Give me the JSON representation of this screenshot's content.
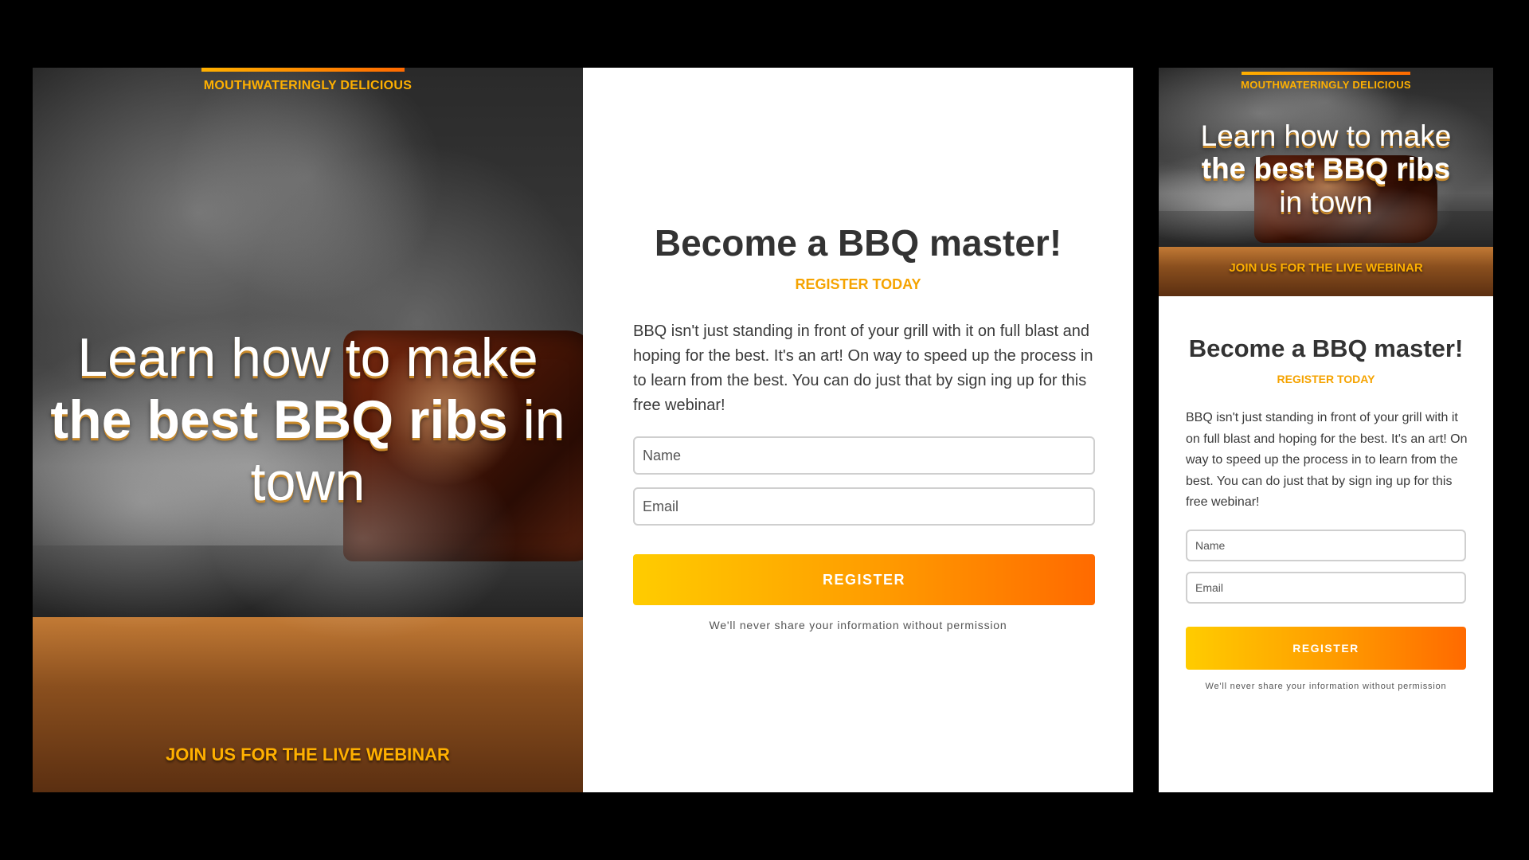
{
  "desktop": {
    "hero": {
      "kicker": "MOUTHWATERINGLY DELICIOUS",
      "title_line1": "Learn how to make",
      "title_bold": "the best BBQ ribs",
      "title_in": " in",
      "title_line3": "town",
      "footer": "JOIN US FOR THE LIVE WEBINAR"
    },
    "form": {
      "title": "Become a BBQ master!",
      "subtitle": "REGISTER TODAY",
      "body": "BBQ isn't just standing in front of your grill with it on full blast and hoping for the best. It's an art! On way to speed up the process in to learn from the best. You can do just that by sign ing up for this free webinar!",
      "name_placeholder": "Name",
      "email_placeholder": "Email",
      "button": "REGISTER",
      "privacy": "We'll never share your information without permission"
    }
  },
  "mobile": {
    "hero": {
      "kicker": "MOUTHWATERINGLY DELICIOUS",
      "title_line1": "Learn how to make",
      "title_bold": "the best BBQ ribs",
      "title_line3": "in town",
      "footer": "JOIN US FOR THE LIVE WEBINAR"
    },
    "form": {
      "title": "Become a BBQ master!",
      "subtitle": "REGISTER TODAY",
      "body": "BBQ isn't just standing in front of your grill with it on full blast and hoping for the best. It's an art! On way to speed up the process in to learn from the best. You can do just that by sign ing up for this free webinar!",
      "name_placeholder": "Name",
      "email_placeholder": "Email",
      "button": "REGISTER",
      "privacy": "We'll never share your information without permission"
    }
  },
  "colors": {
    "accent": "#ffb000",
    "button_start": "#ffcc00",
    "button_end": "#ff6a00",
    "title_text": "#333333",
    "page_bg": "#000000"
  }
}
